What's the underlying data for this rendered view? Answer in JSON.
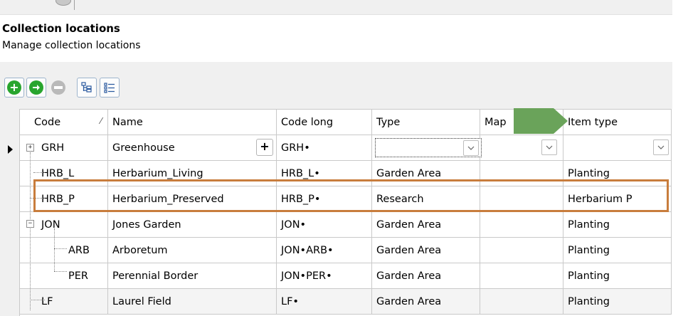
{
  "header": {
    "title": "Collection locations",
    "subtitle": "Manage collection locations"
  },
  "toolbar": {
    "buttons": [
      {
        "icon": "add-icon",
        "symbol": "+"
      },
      {
        "icon": "next-icon",
        "symbol": "➜"
      },
      {
        "icon": "remove-icon",
        "symbol": "—"
      },
      {
        "icon": "tree-view-icon"
      },
      {
        "icon": "list-view-icon"
      }
    ]
  },
  "grid": {
    "columns": {
      "code": "Code",
      "name": "Name",
      "code_long": "Code long",
      "type": "Type",
      "map": "Map",
      "item_type": "Item type"
    },
    "rows": [
      {
        "code": "GRH",
        "name": "Greenhouse",
        "code_long": "GRH•",
        "type": "",
        "map": "",
        "item_type": ""
      },
      {
        "code": "HRB_L",
        "name": "Herbarium_Living",
        "code_long": "HRB_L•",
        "type": "Garden Area",
        "map": "",
        "item_type": "Planting"
      },
      {
        "code": "HRB_P",
        "name": "Herbarium_Preserved",
        "code_long": "HRB_P•",
        "type": "Research",
        "map": "",
        "item_type": "Herbarium P"
      },
      {
        "code": "JON",
        "name": "Jones Garden",
        "code_long": "JON•",
        "type": "Garden Area",
        "map": "",
        "item_type": "Planting"
      },
      {
        "code": "ARB",
        "name": "Arboretum",
        "code_long": "JON•ARB•",
        "type": "Garden Area",
        "map": "",
        "item_type": "Planting"
      },
      {
        "code": "PER",
        "name": "Perennial Border",
        "code_long": "JON•PER•",
        "type": "Garden Area",
        "map": "",
        "item_type": "Planting"
      },
      {
        "code": "LF",
        "name": "Laurel Field",
        "code_long": "LF•",
        "type": "Garden Area",
        "map": "",
        "item_type": "Planting"
      }
    ]
  },
  "colors": {
    "highlight": "#c87d3d",
    "arrow": "#6aa35a",
    "add_green": "#28a52e"
  }
}
